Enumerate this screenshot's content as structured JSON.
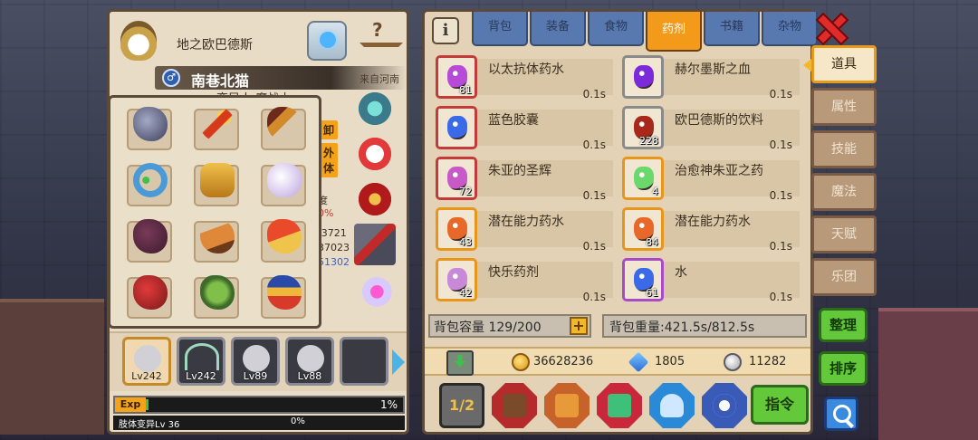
{
  "character": {
    "race": "地之欧巴德斯",
    "gender_symbol": "♂",
    "name": "南巷北猫",
    "origin": "来自河南",
    "partial_title": "变异人 魔战士",
    "side_tags": [
      "卸",
      "外体"
    ],
    "stat_fragments": [
      "度",
      "0%",
      "/3721",
      "37023",
      "51302"
    ]
  },
  "equipment": [
    {
      "icon": "armor-dark"
    },
    {
      "icon": "fire-staff"
    },
    {
      "icon": "magic-axe"
    },
    {
      "icon": "sapphire-ring"
    },
    {
      "icon": "golden-armor"
    },
    {
      "icon": "white-gloves"
    },
    {
      "icon": "dark-cloak"
    },
    {
      "icon": "leather-boots"
    },
    {
      "icon": "red-boots"
    },
    {
      "icon": "red-gauntlets"
    },
    {
      "icon": "winged-helmet"
    },
    {
      "icon": "royal-armor"
    }
  ],
  "accessories": [
    {
      "icon": "crystal-amulet"
    },
    {
      "icon": "flower-charm"
    },
    {
      "icon": "treasure-relic"
    },
    {
      "icon": "stone-block"
    },
    {
      "icon": "pink-crystal"
    }
  ],
  "party": [
    {
      "level": "Lv242",
      "active": true
    },
    {
      "level": "Lv242",
      "active": false
    },
    {
      "level": "Lv89",
      "active": false
    },
    {
      "level": "Lv88",
      "active": false
    },
    {
      "level": "",
      "active": false
    }
  ],
  "exp": {
    "label": "Exp",
    "percent_text": "1%",
    "fill": 0.01
  },
  "sub_exp": {
    "label": "肢体变异Lv 36",
    "percent_text": "0%"
  },
  "tabs": [
    {
      "label": "背包",
      "active": false
    },
    {
      "label": "装备",
      "active": false
    },
    {
      "label": "食物",
      "active": false
    },
    {
      "label": "药剂",
      "active": true
    },
    {
      "label": "书籍",
      "active": false
    },
    {
      "label": "杂物",
      "active": false
    }
  ],
  "info_button": "i",
  "items": [
    {
      "name": "以太抗体药水",
      "count": "81",
      "weight": "0.1s",
      "color": "#b84ad8",
      "frame": "red-b",
      "col": 0
    },
    {
      "name": "赫尔墨斯之血",
      "count": "",
      "weight": "0.1s",
      "color": "#7a2ad8",
      "frame": "gray-b",
      "col": 1
    },
    {
      "name": "蓝色胶囊",
      "count": "",
      "weight": "0.1s",
      "color": "#3a6ae8",
      "frame": "red-b",
      "col": 0
    },
    {
      "name": "欧巴德斯的饮料",
      "count": "228",
      "weight": "0.1s",
      "color": "#a8281a",
      "frame": "gray-b",
      "col": 1
    },
    {
      "name": "朱亚的圣辉",
      "count": "72",
      "weight": "0.1s",
      "color": "#c85ac8",
      "frame": "red-b",
      "col": 0
    },
    {
      "name": "治愈神朱亚之药",
      "count": "4",
      "weight": "0.1s",
      "color": "#6ad86a",
      "frame": "orange-b",
      "col": 1
    },
    {
      "name": "潜在能力药水",
      "count": "43",
      "weight": "0.1s",
      "color": "#e8682a",
      "frame": "orange-b",
      "col": 0
    },
    {
      "name": "潜在能力药水",
      "count": "84",
      "weight": "0.1s",
      "color": "#e8682a",
      "frame": "orange-b",
      "col": 1
    },
    {
      "name": "快乐药剂",
      "count": "42",
      "weight": "0.1s",
      "color": "#c88ad8",
      "frame": "orange-b",
      "col": 0
    },
    {
      "name": "水",
      "count": "61",
      "weight": "0.1s",
      "color": "#3a6ae8",
      "frame": "purple-b",
      "col": 1
    }
  ],
  "bag": {
    "capacity": "背包容量 129/200",
    "plus": "+",
    "weight": "背包重量:421.5s/812.5s"
  },
  "currency": {
    "gold": "36628236",
    "gem": "1805",
    "silver": "11282"
  },
  "bottom_buttons": [
    {
      "icon": "page-toggle-icon"
    },
    {
      "icon": "treasure-chest-icon"
    },
    {
      "icon": "backpack-icon"
    },
    {
      "icon": "green-book-icon"
    },
    {
      "icon": "flask-icon"
    },
    {
      "icon": "ring-icon"
    }
  ],
  "command_button": "指令",
  "side_menu": [
    {
      "label": "道具",
      "active": true
    },
    {
      "label": "属性",
      "active": false
    },
    {
      "label": "技能",
      "active": false
    },
    {
      "label": "魔法",
      "active": false
    },
    {
      "label": "天赋",
      "active": false
    },
    {
      "label": "乐团",
      "active": false
    }
  ],
  "actions": {
    "organize": "整理",
    "sort": "排序"
  }
}
